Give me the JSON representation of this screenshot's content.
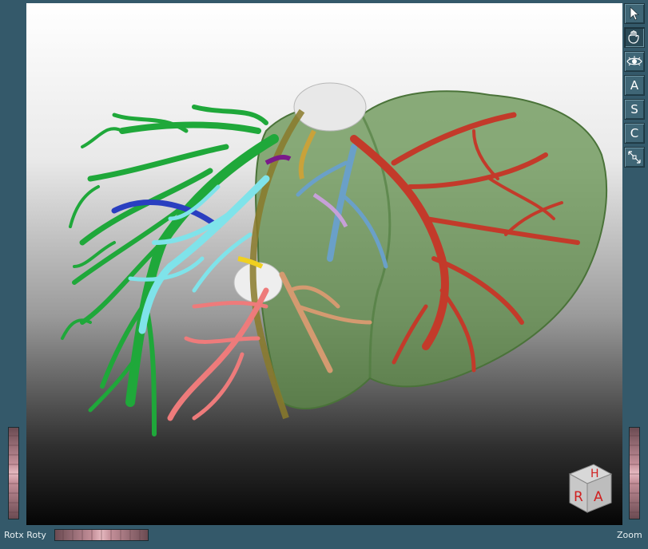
{
  "toolbar": {
    "items": [
      {
        "name": "pointer-tool",
        "icon": "arrow-pointer-icon",
        "label": "",
        "active": false
      },
      {
        "name": "hand-tool",
        "icon": "hand-icon",
        "label": "",
        "active": true
      },
      {
        "name": "eye-tool",
        "icon": "eye-icon",
        "label": "",
        "active": false
      },
      {
        "name": "axial-view",
        "icon": "",
        "label": "A",
        "active": false
      },
      {
        "name": "sagittal-view",
        "icon": "",
        "label": "S",
        "active": false
      },
      {
        "name": "coronal-view",
        "icon": "",
        "label": "C",
        "active": false
      },
      {
        "name": "reset-view",
        "icon": "orientation-arrows-icon",
        "label": "",
        "active": false
      }
    ]
  },
  "orientation_cube": {
    "top": "H",
    "left": "R",
    "right": "A"
  },
  "bottom_bar": {
    "rotation_label": "Rotx Roty",
    "zoom_label": "Zoom"
  },
  "colors": {
    "frame": "#34596a",
    "portal_vein": "#1fa83a",
    "hepatic_artery": "#7fe3ea",
    "hepatic_vein": "#c33a2a",
    "liver_surface": "#5f8f4a",
    "segment_pink": "#ee7b7b",
    "segment_tan": "#d49a70",
    "segment_blue": "#6aa0c8",
    "slider": "#c48f99"
  }
}
